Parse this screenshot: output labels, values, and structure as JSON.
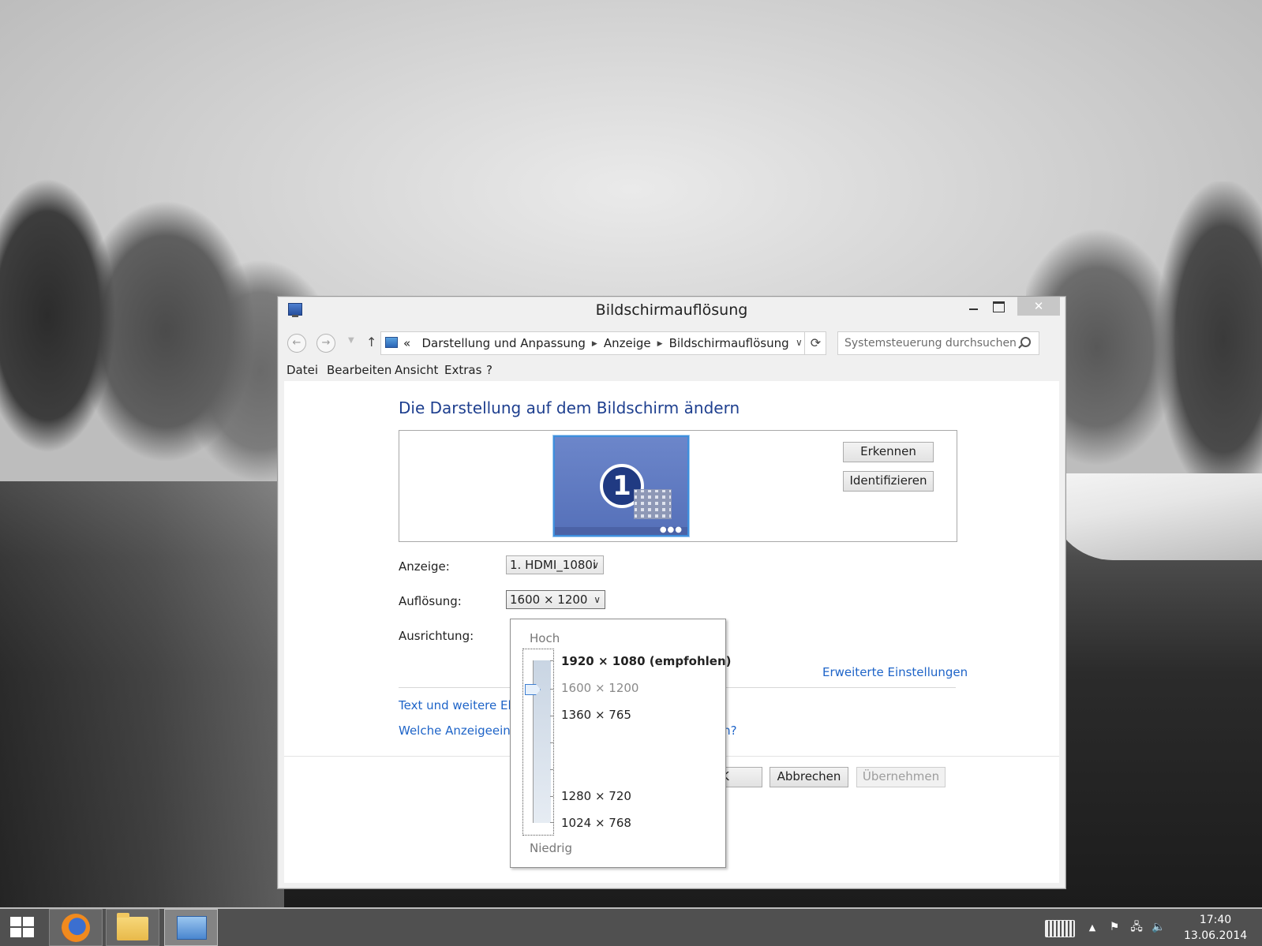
{
  "window": {
    "title": "Bildschirmauflösung",
    "close_glyph": "✕"
  },
  "nav": {
    "back_icon": "←",
    "forward_icon": "→",
    "up_icon": "↑",
    "crumb_prefix": "«",
    "crumbs": [
      "Darstellung und Anpassung",
      "Anzeige",
      "Bildschirmauflösung"
    ],
    "search_placeholder": "Systemsteuerung durchsuchen"
  },
  "menu": [
    "Datei",
    "Bearbeiten",
    "Ansicht",
    "Extras",
    "?"
  ],
  "main": {
    "heading": "Die Darstellung auf dem Bildschirm ändern",
    "monitor_number": "1",
    "detect_button": "Erkennen",
    "identify_button": "Identifizieren",
    "display_label": "Anzeige:",
    "display_value": "1. HDMI_1080i",
    "resolution_label": "Auflösung:",
    "resolution_value": "1600 × 1200",
    "orientation_label": "Ausrichtung:",
    "advanced_link": "Erweiterte Einstellungen",
    "link_text_size": "Text und weitere Elemente vergrößern oder verkleinern",
    "link_which_settings": "Welche Anzeigeeinstellungen sollen ausgewählt werden?",
    "ok_button": "OK",
    "cancel_button": "Abbrechen",
    "apply_button": "Übernehmen"
  },
  "resolution_dropdown": {
    "high_label": "Hoch",
    "low_label": "Niedrig",
    "options": [
      "1920 × 1080 (empfohlen)",
      "1600 × 1200",
      "1360 × 765",
      "1280 × 720",
      "1024 × 768"
    ],
    "selected": "1600 × 1200"
  },
  "taskbar": {
    "apps": [
      "firefox-icon",
      "file-explorer-icon",
      "control-panel-icon"
    ],
    "time": "17:40",
    "date": "13.06.2014"
  }
}
